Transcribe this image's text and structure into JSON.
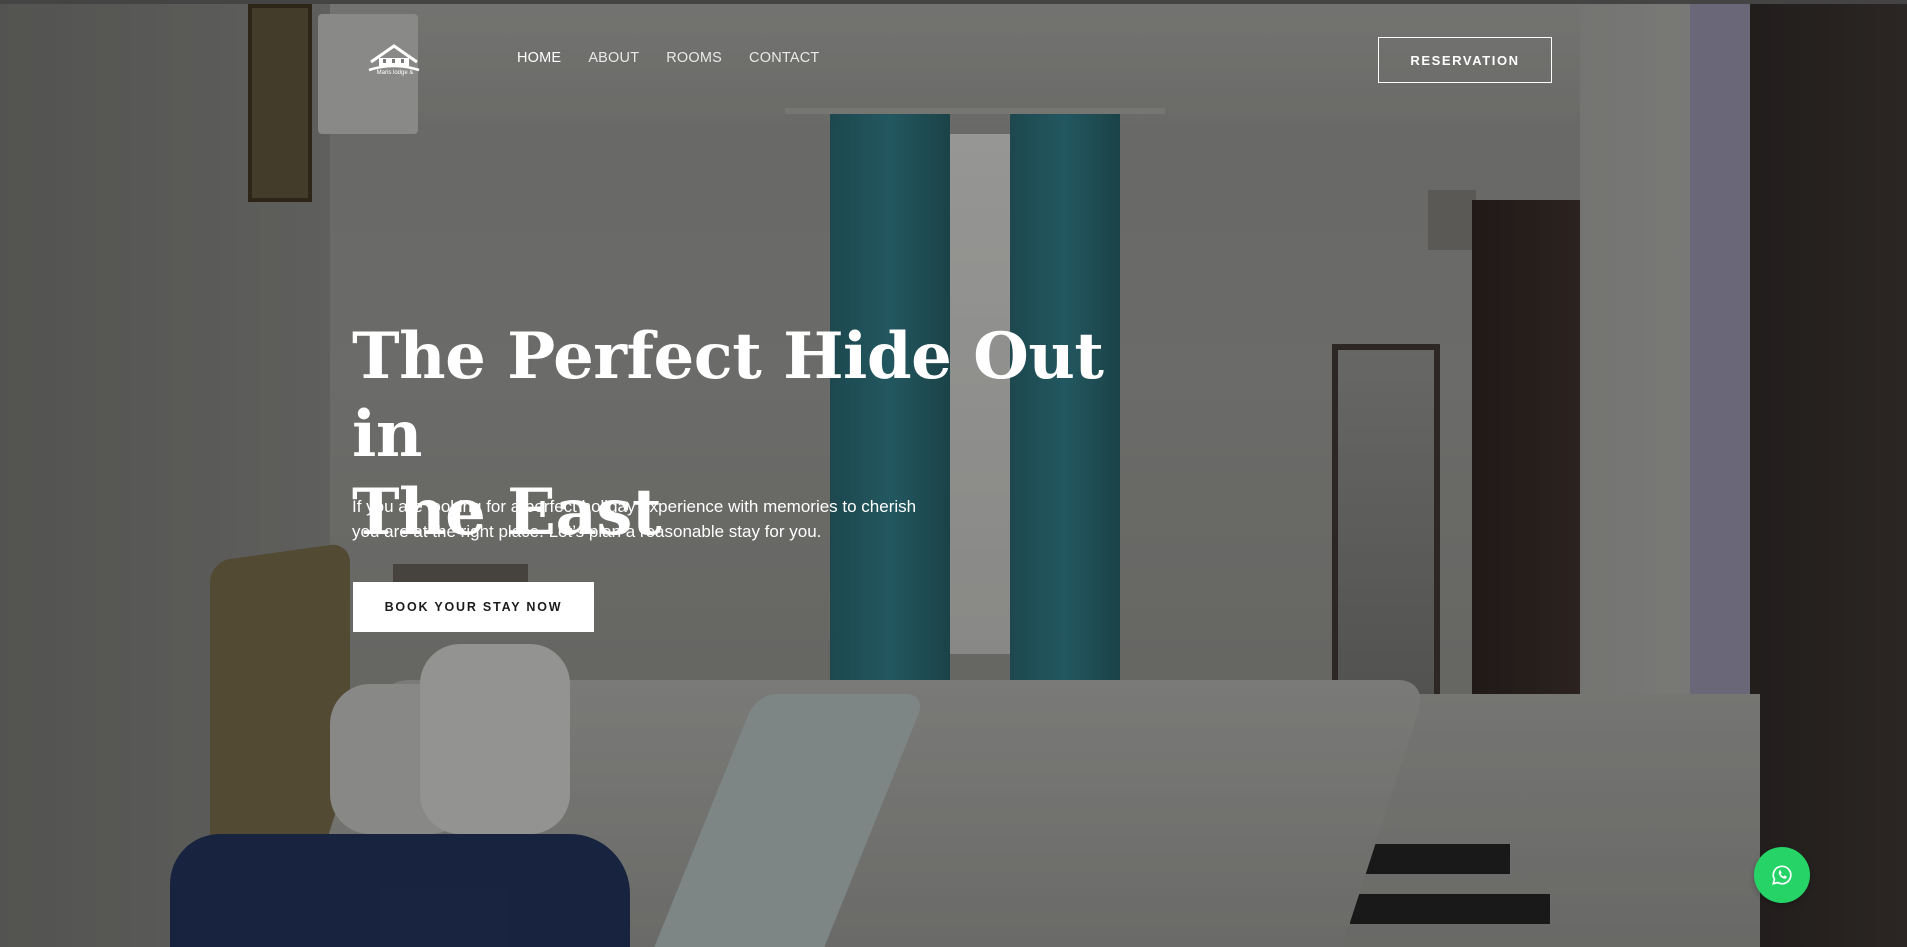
{
  "header": {
    "logo_text": "Maris lodge &",
    "nav": [
      {
        "label": "HOME",
        "active": true
      },
      {
        "label": "ABOUT",
        "active": false
      },
      {
        "label": "ROOMS",
        "active": false
      },
      {
        "label": "CONTACT",
        "active": false
      }
    ],
    "reservation_label": "RESERVATION"
  },
  "hero": {
    "title_line1": "The Perfect Hide Out in",
    "title_line2": "The East",
    "subtitle": "If you are looking for a perfect holiday experience with memories to cherish you are at the right place. Let’s plan a reasonable stay for you.",
    "cta_label": "BOOK YOUR STAY NOW"
  },
  "floating": {
    "whatsapp_icon": "whatsapp-icon",
    "whatsapp_color": "#25d366"
  },
  "colors": {
    "text": "#ffffff",
    "button_bg": "#ffffff",
    "button_text": "#1b1b1b"
  }
}
